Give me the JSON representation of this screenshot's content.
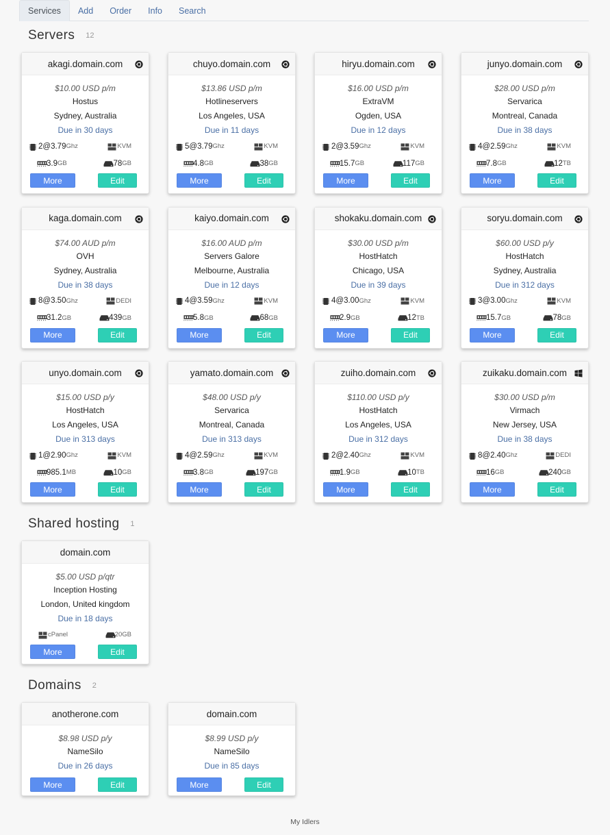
{
  "nav": {
    "tabs": [
      "Services",
      "Add",
      "Order",
      "Info",
      "Search"
    ],
    "active": "Services"
  },
  "sections": {
    "servers": {
      "title": "Servers",
      "count": "12"
    },
    "shared": {
      "title": "Shared hosting",
      "count": "1"
    },
    "domains": {
      "title": "Domains",
      "count": "2"
    }
  },
  "buttons": {
    "more": "More",
    "edit": "Edit"
  },
  "colors": {
    "more_button": "#5b8ef0",
    "edit_button": "#2ecfb5",
    "due_text": "#4a6fa5"
  },
  "servers": [
    {
      "hostname": "akagi.domain.com",
      "os": "ubuntu-icon",
      "price": "$10.00 USD p/m",
      "provider": "Hostus",
      "location": "Sydney, Australia",
      "due": "Due in 30 days",
      "cpu": "2",
      "cpu_freq": "@3.79",
      "cpu_unit": "Ghz",
      "virt": "KVM",
      "ram": "3.9",
      "ram_unit": "GB",
      "disk": "78",
      "disk_unit": "GB"
    },
    {
      "hostname": "chuyo.domain.com",
      "os": "ubuntu-icon",
      "price": "$13.86 USD p/m",
      "provider": "Hotlineservers",
      "location": "Los Angeles, USA",
      "due": "Due in 11 days",
      "cpu": "5",
      "cpu_freq": "@3.79",
      "cpu_unit": "Ghz",
      "virt": "KVM",
      "ram": "4.8",
      "ram_unit": "GB",
      "disk": "38",
      "disk_unit": "GB"
    },
    {
      "hostname": "hiryu.domain.com",
      "os": "ubuntu-icon",
      "price": "$16.00 USD p/m",
      "provider": "ExtraVM",
      "location": "Ogden, USA",
      "due": "Due in 12 days",
      "cpu": "2",
      "cpu_freq": "@3.59",
      "cpu_unit": "Ghz",
      "virt": "KVM",
      "ram": "15.7",
      "ram_unit": "GB",
      "disk": "117",
      "disk_unit": "GB"
    },
    {
      "hostname": "junyo.domain.com",
      "os": "ubuntu-icon",
      "price": "$28.00 USD p/m",
      "provider": "Servarica",
      "location": "Montreal, Canada",
      "due": "Due in 38 days",
      "cpu": "4",
      "cpu_freq": "@2.59",
      "cpu_unit": "Ghz",
      "virt": "KVM",
      "ram": "7.8",
      "ram_unit": "GB",
      "disk": "12",
      "disk_unit": "TB"
    },
    {
      "hostname": "kaga.domain.com",
      "os": "ubuntu-icon",
      "price": "$74.00 AUD p/m",
      "provider": "OVH",
      "location": "Sydney, Australia",
      "due": "Due in 38 days",
      "cpu": "8",
      "cpu_freq": "@3.50",
      "cpu_unit": "Ghz",
      "virt": "DEDI",
      "ram": "31.2",
      "ram_unit": "GB",
      "disk": "439",
      "disk_unit": "GB"
    },
    {
      "hostname": "kaiyo.domain.com",
      "os": "ubuntu-icon",
      "price": "$16.00 AUD p/m",
      "provider": "Servers Galore",
      "location": "Melbourne, Australia",
      "due": "Due in 12 days",
      "cpu": "4",
      "cpu_freq": "@3.59",
      "cpu_unit": "Ghz",
      "virt": "KVM",
      "ram": "5.8",
      "ram_unit": "GB",
      "disk": "68",
      "disk_unit": "GB"
    },
    {
      "hostname": "shokaku.domain.com",
      "os": "ubuntu-icon",
      "price": "$30.00 USD p/m",
      "provider": "HostHatch",
      "location": "Chicago, USA",
      "due": "Due in 39 days",
      "cpu": "4",
      "cpu_freq": "@3.00",
      "cpu_unit": "Ghz",
      "virt": "KVM",
      "ram": "2.9",
      "ram_unit": "GB",
      "disk": "12",
      "disk_unit": "TB"
    },
    {
      "hostname": "soryu.domain.com",
      "os": "ubuntu-icon",
      "price": "$60.00 USD p/y",
      "provider": "HostHatch",
      "location": "Sydney, Australia",
      "due": "Due in 312 days",
      "cpu": "3",
      "cpu_freq": "@3.00",
      "cpu_unit": "Ghz",
      "virt": "KVM",
      "ram": "15.7",
      "ram_unit": "GB",
      "disk": "78",
      "disk_unit": "GB"
    },
    {
      "hostname": "unyo.domain.com",
      "os": "ubuntu-icon",
      "price": "$15.00 USD p/y",
      "provider": "HostHatch",
      "location": "Los Angeles, USA",
      "due": "Due in 313 days",
      "cpu": "1",
      "cpu_freq": "@2.90",
      "cpu_unit": "Ghz",
      "virt": "KVM",
      "ram": "985.1",
      "ram_unit": "MB",
      "disk": "10",
      "disk_unit": "GB"
    },
    {
      "hostname": "yamato.domain.com",
      "os": "ubuntu-icon",
      "price": "$48.00 USD p/y",
      "provider": "Servarica",
      "location": "Montreal, Canada",
      "due": "Due in 313 days",
      "cpu": "4",
      "cpu_freq": "@2.59",
      "cpu_unit": "Ghz",
      "virt": "KVM",
      "ram": "3.8",
      "ram_unit": "GB",
      "disk": "197",
      "disk_unit": "GB"
    },
    {
      "hostname": "zuiho.domain.com",
      "os": "ubuntu-icon",
      "price": "$110.00 USD p/y",
      "provider": "HostHatch",
      "location": "Los Angeles, USA",
      "due": "Due in 312 days",
      "cpu": "2",
      "cpu_freq": "@2.40",
      "cpu_unit": "Ghz",
      "virt": "KVM",
      "ram": "1.9",
      "ram_unit": "GB",
      "disk": "10",
      "disk_unit": "TB"
    },
    {
      "hostname": "zuikaku.domain.com",
      "os": "windows-icon",
      "price": "$30.00 USD p/m",
      "provider": "Virmach",
      "location": "New Jersey, USA",
      "due": "Due in 38 days",
      "cpu": "8",
      "cpu_freq": "@2.40",
      "cpu_unit": "Ghz",
      "virt": "DEDI",
      "ram": "16",
      "ram_unit": "GB",
      "disk": "240",
      "disk_unit": "GB"
    }
  ],
  "shared": [
    {
      "hostname": "domain.com",
      "price": "$5.00 USD p/qtr",
      "provider": "Inception Hosting",
      "location": "London, United kingdom",
      "due": "Due in 18 days",
      "panel": "cPanel",
      "disk": "20",
      "disk_unit": "GB"
    }
  ],
  "domains": [
    {
      "domain": "anotherone.com",
      "price": "$8.98 USD p/y",
      "registrar": "NameSilo",
      "due": "Due in 26 days"
    },
    {
      "domain": "domain.com",
      "price": "$8.99 USD p/y",
      "registrar": "NameSilo",
      "due": "Due in 85 days"
    }
  ],
  "footer": "My Idlers"
}
